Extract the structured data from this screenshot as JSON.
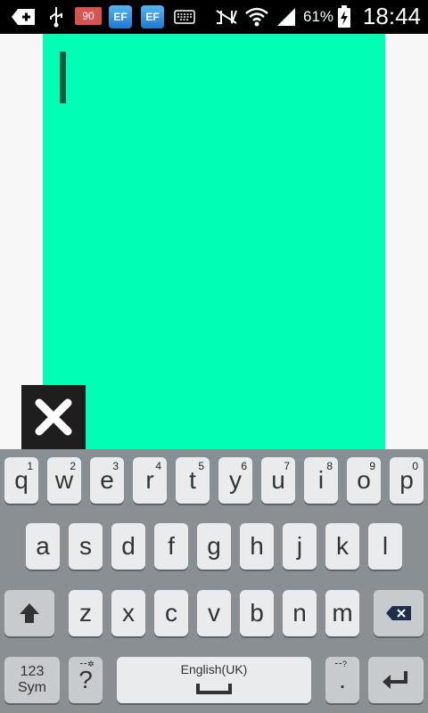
{
  "status_bar": {
    "badge_number": "90",
    "ef_label": "EF",
    "battery_percent": "61%",
    "time": "18:44"
  },
  "canvas": {
    "background_color": "#00ffb4"
  },
  "overlay": {
    "close_label": "✕"
  },
  "keyboard": {
    "row1": [
      {
        "key": "q",
        "sub": "1"
      },
      {
        "key": "w",
        "sub": "2"
      },
      {
        "key": "e",
        "sub": "3"
      },
      {
        "key": "r",
        "sub": "4"
      },
      {
        "key": "t",
        "sub": "5"
      },
      {
        "key": "y",
        "sub": "6"
      },
      {
        "key": "u",
        "sub": "7"
      },
      {
        "key": "i",
        "sub": "8"
      },
      {
        "key": "o",
        "sub": "9"
      },
      {
        "key": "p",
        "sub": "0"
      }
    ],
    "row2": [
      "a",
      "s",
      "d",
      "f",
      "g",
      "h",
      "j",
      "k",
      "l"
    ],
    "row3": [
      "z",
      "x",
      "c",
      "v",
      "b",
      "n",
      "m"
    ],
    "sym_line1": "123",
    "sym_line2": "Sym",
    "question": "?",
    "question_sub": "⁃⁃✲",
    "space_label": "English(UK)",
    "period": ".",
    "period_sub": "⁃⁃?"
  }
}
